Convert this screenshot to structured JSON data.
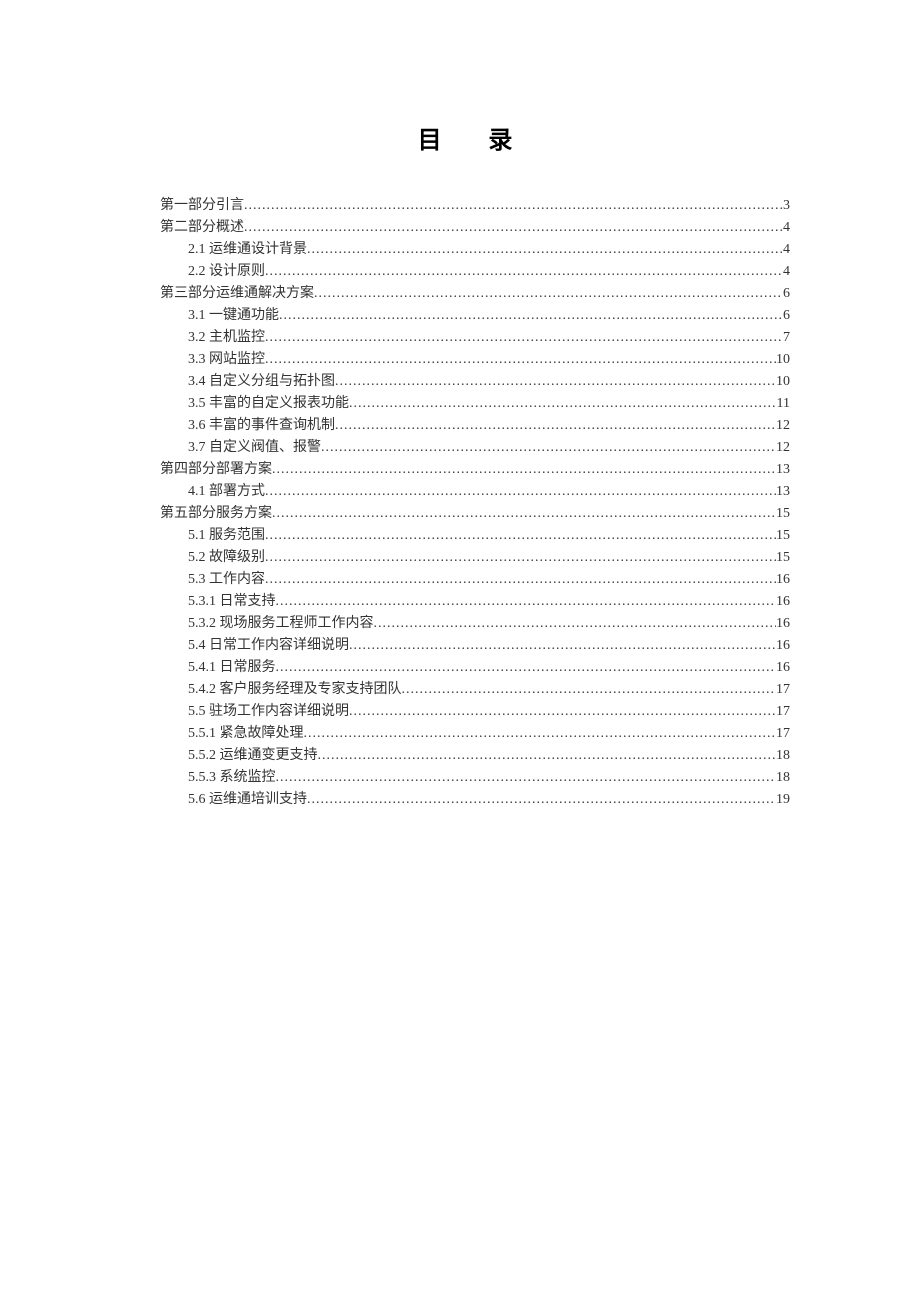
{
  "title": "目 录",
  "entries": [
    {
      "level": 1,
      "label": "第一部分引言",
      "page": "3"
    },
    {
      "level": 1,
      "label": "第二部分概述",
      "page": "4"
    },
    {
      "level": 2,
      "label": "2.1 运维通设计背景",
      "page": "4"
    },
    {
      "level": 2,
      "label": "2.2 设计原则",
      "page": "4"
    },
    {
      "level": 1,
      "label": "第三部分运维通解决方案",
      "page": "6"
    },
    {
      "level": 2,
      "label": "3.1  一键通功能",
      "page": "6"
    },
    {
      "level": 2,
      "label": "3.2 主机监控",
      "page": "7"
    },
    {
      "level": 2,
      "label": "3.3 网站监控",
      "page": "10"
    },
    {
      "level": 2,
      "label": "3.4 自定义分组与拓扑图",
      "page": "10"
    },
    {
      "level": 2,
      "label": "3.5 丰富的自定义报表功能",
      "page": "11"
    },
    {
      "level": 2,
      "label": "3.6 丰富的事件查询机制",
      "page": "12"
    },
    {
      "level": 2,
      "label": "3.7 自定义阀值、报警",
      "page": "12"
    },
    {
      "level": 1,
      "label": "第四部分部署方案",
      "page": "13"
    },
    {
      "level": 2,
      "label": "4.1  部署方式",
      "page": "13"
    },
    {
      "level": 1,
      "label": "第五部分服务方案",
      "page": "15"
    },
    {
      "level": 2,
      "label": "5.1 服务范围",
      "page": "15"
    },
    {
      "level": 2,
      "label": "5.2 故障级别",
      "page": "15"
    },
    {
      "level": 2,
      "label": "5.3 工作内容",
      "page": "16"
    },
    {
      "level": 2,
      "label": "5.3.1 日常支持",
      "page": "16"
    },
    {
      "level": 2,
      "label": "5.3.2 现场服务工程师工作内容",
      "page": "16"
    },
    {
      "level": 2,
      "label": "5.4 日常工作内容详细说明",
      "page": "16"
    },
    {
      "level": 2,
      "label": "5.4.1 日常服务",
      "page": "16"
    },
    {
      "level": 2,
      "label": "5.4.2 客户服务经理及专家支持团队",
      "page": "17"
    },
    {
      "level": 2,
      "label": "5.5  驻场工作内容详细说明",
      "page": "17"
    },
    {
      "level": 2,
      "label": "5.5.1 紧急故障处理",
      "page": "17"
    },
    {
      "level": 2,
      "label": "5.5.2 运维通变更支持",
      "page": "18"
    },
    {
      "level": 2,
      "label": "5.5.3 系统监控",
      "page": "18"
    },
    {
      "level": 2,
      "label": "5.6  运维通培训支持",
      "page": "19"
    }
  ]
}
